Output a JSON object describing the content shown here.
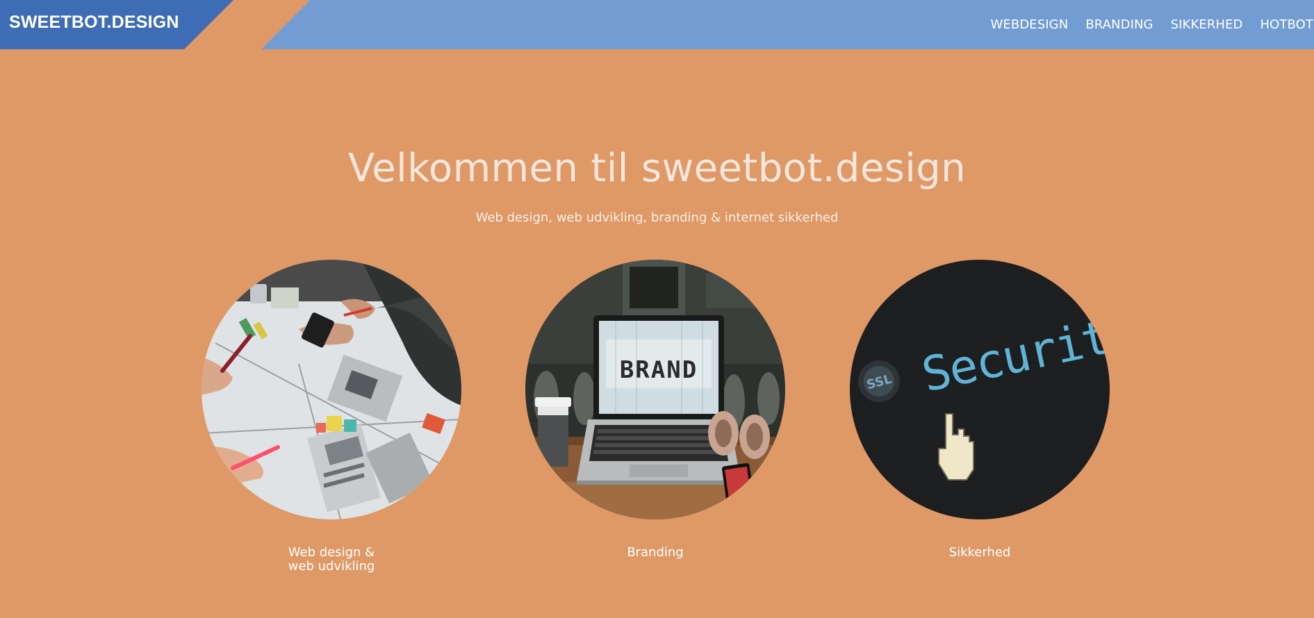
{
  "header": {
    "logo": "SWEETBOT.DESIGN",
    "nav": [
      "WEBDESIGN",
      "BRANDING",
      "SIKKERHED",
      "HOTBOT"
    ]
  },
  "hero": {
    "title": "Velkommen til sweetbot.design",
    "subtitle": "Web design, web udvikling, branding & internet sikkerhed"
  },
  "services": [
    {
      "label_line1": "Web design &",
      "label_line2": "web udvikling",
      "image": "design-workspace-photo"
    },
    {
      "label": "Branding",
      "image": "laptop-brand-photo",
      "screen_text": "BRAND"
    },
    {
      "label": "Sikkerhed",
      "image": "security-screen-photo",
      "screen_text": "Security"
    }
  ],
  "colors": {
    "background": "#DE9966",
    "header_dark_blue": "#3E6DB5",
    "header_light_blue": "#739CD3",
    "title_text": "#F8E6DC"
  }
}
